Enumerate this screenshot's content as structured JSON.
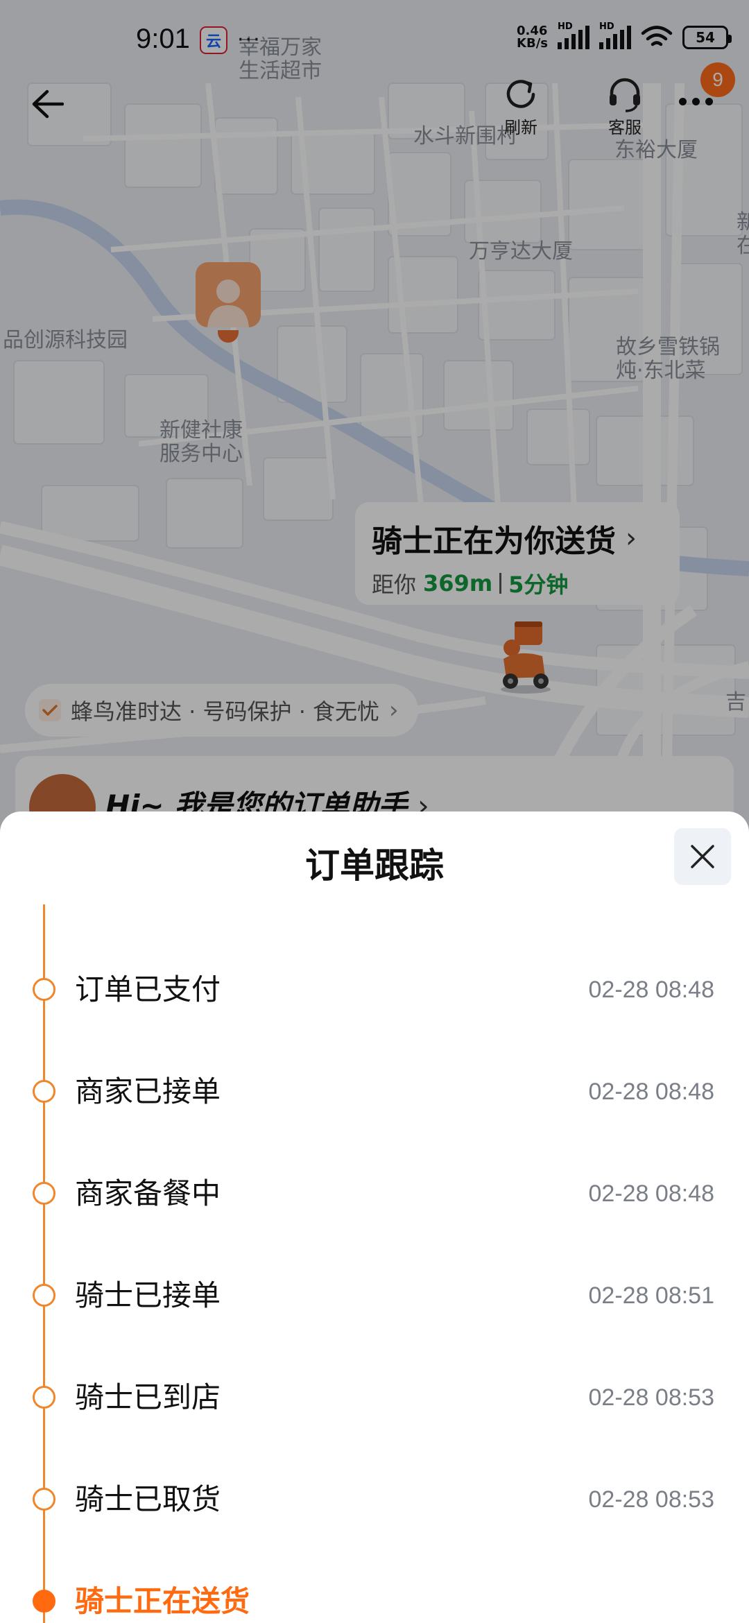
{
  "status_bar": {
    "time": "9:01",
    "app_icon_text": "云",
    "more_indicator": "···",
    "net_speed_value": "0.46",
    "net_speed_unit": "KB/s",
    "sim1_tag": "HD",
    "sim2_tag": "HD",
    "battery": "54"
  },
  "nav": {
    "refresh_label": "刷新",
    "service_label": "客服",
    "notification_count": "9"
  },
  "map": {
    "labels": [
      "幸福万家\n生活超市",
      "水斗新围村",
      "东裕大厦",
      "万亨达大厦",
      "品创源科技园",
      "故乡雪铁锅\n炖·东北菜",
      "新健社康\n服务中心",
      "吉",
      "新\n在"
    ]
  },
  "delivery_bubble": {
    "title": "骑士正在为你送货",
    "distance_prefix": "距你",
    "distance": "369m",
    "eta": "5分钟"
  },
  "guarantee_chip": {
    "text": "蜂鸟准时达 · 号码保护 · 食无忧"
  },
  "assistant": {
    "text": "Hi~ 我是您的订单助手"
  },
  "sheet": {
    "title": "订单跟踪",
    "steps": [
      {
        "label": "订单已支付",
        "time": "02-28 08:48"
      },
      {
        "label": "商家已接单",
        "time": "02-28 08:48"
      },
      {
        "label": "商家备餐中",
        "time": "02-28 08:48"
      },
      {
        "label": "骑士已接单",
        "time": "02-28 08:51"
      },
      {
        "label": "骑士已到店",
        "time": "02-28 08:53"
      },
      {
        "label": "骑士已取货",
        "time": "02-28 08:53"
      },
      {
        "label": "骑士正在送货",
        "time": ""
      }
    ]
  },
  "colors": {
    "accent": "#ff6a10",
    "timeline": "#f0862b",
    "eta_green": "#14993f",
    "badge": "#ff6a1a"
  }
}
